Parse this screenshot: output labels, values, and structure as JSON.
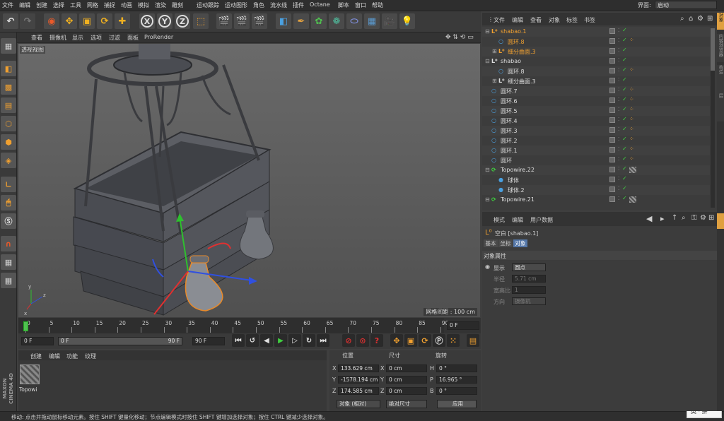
{
  "menu": {
    "items": [
      "文件",
      "编辑",
      "创建",
      "选择",
      "工具",
      "网格",
      "捕捉",
      "动画",
      "模拟",
      "渲染",
      "雕刻",
      "运动跟踪",
      "运动图形",
      "角色",
      "流水线",
      "插件",
      "Octane",
      "脚本",
      "窗口",
      "帮助"
    ],
    "layout_label": "界面:",
    "layout_value": "启动"
  },
  "viewport": {
    "menu": [
      "查看",
      "摄像机",
      "显示",
      "选项",
      "过滤",
      "面板",
      "ProRender"
    ],
    "label": "透视视图",
    "grid_info": "网格间距 : 100 cm"
  },
  "timeline": {
    "ticks": [
      "0",
      "5",
      "10",
      "15",
      "20",
      "25",
      "30",
      "35",
      "40",
      "45",
      "50",
      "55",
      "60",
      "65",
      "70",
      "75",
      "80",
      "85",
      "90"
    ],
    "frame_field": "0 F"
  },
  "playbar": {
    "start": "0 F",
    "slider": "0 F",
    "slider_end": "90 F",
    "end": "90 F"
  },
  "material": {
    "tabs": [
      "创建",
      "编辑",
      "功能",
      "纹理"
    ],
    "item_name": "Topowi",
    "brand_top": "MAXON",
    "brand_bottom": "CINEMA 4D"
  },
  "coords": {
    "headers": [
      "位置",
      "尺寸",
      "旋转"
    ],
    "rows": [
      {
        "axis": "X",
        "pos": "133.629 cm",
        "saxis": "X",
        "size": "0 cm",
        "raxis": "H",
        "rot": "0 °"
      },
      {
        "axis": "Y",
        "pos": "-1578.194 cm",
        "saxis": "Y",
        "size": "0 cm",
        "raxis": "P",
        "rot": "16.965 °"
      },
      {
        "axis": "Z",
        "pos": "174.585 cm",
        "saxis": "Z",
        "size": "0 cm",
        "raxis": "B",
        "rot": "0 °"
      }
    ],
    "mode1": "对象 (相对)",
    "mode2": "绝对尺寸",
    "apply": "应用"
  },
  "status": "移动: 点击并拖动鼠标移动元素。按住 SHIFT 键量化移动；节点编辑模式时按住 SHIFT 键增加选择对象；按住 CTRL 键减少选择对象。",
  "ime": "英 · 拼",
  "objects": {
    "menu": [
      "文件",
      "编辑",
      "查看",
      "对象",
      "标签",
      "书签"
    ],
    "rows": [
      {
        "name": "shabao.1",
        "indent": 0,
        "type": "null",
        "color": "#f0a030",
        "expand": "-"
      },
      {
        "name": "圆环.8",
        "indent": 1,
        "type": "circle",
        "color": "#f0a030",
        "expand": ""
      },
      {
        "name": "细分曲面.3",
        "indent": 1,
        "type": "null",
        "color": "#f0a030",
        "expand": "+"
      },
      {
        "name": "shabao",
        "indent": 0,
        "type": "null",
        "color": "#dcdcdc",
        "expand": "-"
      },
      {
        "name": "圆环.8",
        "indent": 1,
        "type": "circle",
        "color": "#dcdcdc",
        "expand": ""
      },
      {
        "name": "细分曲面.3",
        "indent": 1,
        "type": "null",
        "color": "#dcdcdc",
        "expand": "+"
      },
      {
        "name": "圆环.7",
        "indent": 0,
        "type": "circle",
        "color": "#dcdcdc",
        "expand": ""
      },
      {
        "name": "圆环.6",
        "indent": 0,
        "type": "circle",
        "color": "#dcdcdc",
        "expand": ""
      },
      {
        "name": "圆环.5",
        "indent": 0,
        "type": "circle",
        "color": "#dcdcdc",
        "expand": ""
      },
      {
        "name": "圆环.4",
        "indent": 0,
        "type": "circle",
        "color": "#dcdcdc",
        "expand": ""
      },
      {
        "name": "圆环.3",
        "indent": 0,
        "type": "circle",
        "color": "#dcdcdc",
        "expand": ""
      },
      {
        "name": "圆环.2",
        "indent": 0,
        "type": "circle",
        "color": "#dcdcdc",
        "expand": ""
      },
      {
        "name": "圆环.1",
        "indent": 0,
        "type": "circle",
        "color": "#dcdcdc",
        "expand": ""
      },
      {
        "name": "圆环",
        "indent": 0,
        "type": "circle",
        "color": "#dcdcdc",
        "expand": ""
      },
      {
        "name": "Topowire.22",
        "indent": 0,
        "type": "topo",
        "color": "#dcdcdc",
        "expand": "-"
      },
      {
        "name": "球体",
        "indent": 1,
        "type": "sphere",
        "color": "#dcdcdc",
        "expand": ""
      },
      {
        "name": "球体.2",
        "indent": 1,
        "type": "sphere",
        "color": "#dcdcdc",
        "expand": ""
      },
      {
        "name": "Topowire.21",
        "indent": 0,
        "type": "topo",
        "color": "#dcdcdc",
        "expand": "-"
      }
    ]
  },
  "attributes": {
    "menu": [
      "模式",
      "编辑",
      "用户数据"
    ],
    "title": "空白 [shabao.1]",
    "tabs": [
      "基本",
      "坐标",
      "对象"
    ],
    "section": "对象属性",
    "props": [
      {
        "label": "显示",
        "value": "圆点"
      },
      {
        "label": "半径",
        "value": "5.71 cm"
      },
      {
        "label": "宽高比",
        "value": "1"
      },
      {
        "label": "方向",
        "value": "摄像机"
      }
    ]
  },
  "right_tabs": [
    "对象",
    "内容浏览器",
    "构造",
    "层"
  ]
}
